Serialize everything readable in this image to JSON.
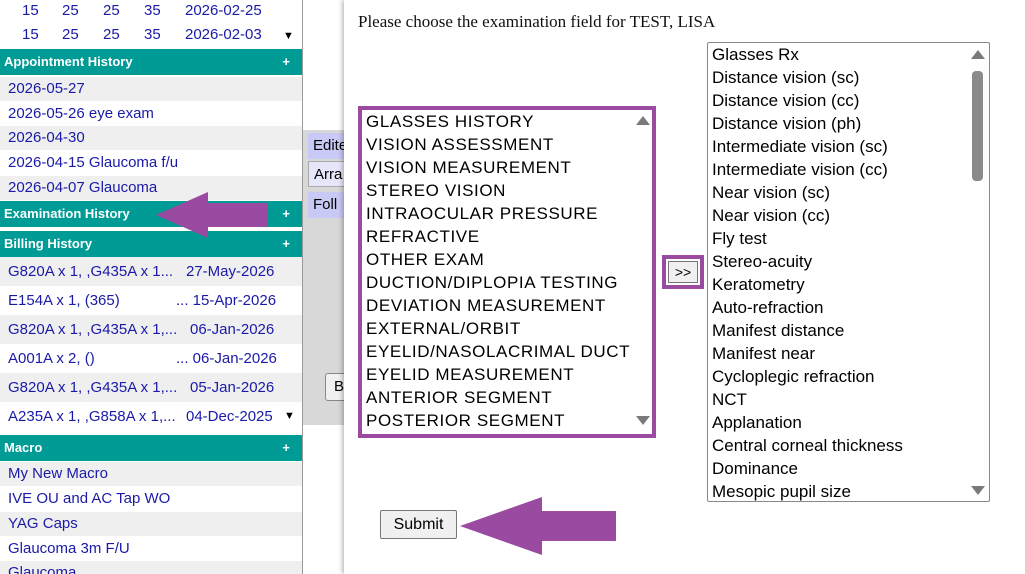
{
  "sidebar": {
    "number_rows": [
      [
        "15",
        "25",
        "25",
        "35",
        "2026-02-25"
      ],
      [
        "15",
        "25",
        "25",
        "35",
        "2026-02-03"
      ]
    ],
    "appointment_history": {
      "title": "Appointment History",
      "plus": "+",
      "items": [
        "2026-05-27",
        "2026-05-26 eye exam",
        "2026-04-30",
        "2026-04-15 Glaucoma f/u",
        "2026-04-07 Glaucoma"
      ]
    },
    "examination_history": {
      "title": "Examination History",
      "plus": "+"
    },
    "billing_history": {
      "title": "Billing History",
      "plus": "+",
      "items": [
        {
          "codes": "G820A x 1, ,G435A x 1...",
          "date": "27-May-2026"
        },
        {
          "codes": "E154A x 1, (365)",
          "date": "... 15-Apr-2026"
        },
        {
          "codes": "G820A x 1, ,G435A x 1,...",
          "date": "06-Jan-2026"
        },
        {
          "codes": "A001A x 2, ()",
          "date": "... 06-Jan-2026"
        },
        {
          "codes": "G820A x 1, ,G435A x 1,...",
          "date": "05-Jan-2026"
        },
        {
          "codes": "A235A x 1, ,G858A x 1,...",
          "date": "04-Dec-2025"
        }
      ]
    },
    "macro": {
      "title": "Macro",
      "plus": "+",
      "items": [
        "My New Macro",
        "IVE OU and AC Tap WO",
        "YAG Caps",
        "Glaucoma 3m F/U",
        "Glaucoma"
      ]
    }
  },
  "background": {
    "tabs": [
      "Edite",
      "Arra",
      "Foll"
    ],
    "button_label": "B"
  },
  "dialog": {
    "prompt": "Please choose the examination field for TEST, LISA",
    "categories": [
      "GLASSES HISTORY",
      "VISION ASSESSMENT",
      "VISION MEASUREMENT",
      "STEREO VISION",
      "INTRAOCULAR PRESSURE",
      "REFRACTIVE",
      "OTHER EXAM",
      "DUCTION/DIPLOPIA TESTING",
      "DEVIATION MEASUREMENT",
      "EXTERNAL/ORBIT",
      "EYELID/NASOLACRIMAL DUCT",
      "EYELID MEASUREMENT",
      "ANTERIOR SEGMENT",
      "POSTERIOR SEGMENT"
    ],
    "move_button": ">>",
    "fields": [
      "Glasses Rx",
      "Distance vision (sc)",
      "Distance vision (cc)",
      "Distance vision (ph)",
      "Intermediate vision (sc)",
      "Intermediate vision (cc)",
      "Near vision (sc)",
      "Near vision (cc)",
      "Fly test",
      "Stereo-acuity",
      "Keratometry",
      "Auto-refraction",
      "Manifest distance",
      "Manifest near",
      "Cycloplegic refraction",
      "NCT",
      "Applanation",
      "Central corneal thickness",
      "Dominance",
      "Mesopic pupil size"
    ],
    "submit_label": "Submit"
  },
  "colors": {
    "section_header": "#009b95",
    "link": "#1a1aa8",
    "highlight": "#9b4aa2"
  }
}
